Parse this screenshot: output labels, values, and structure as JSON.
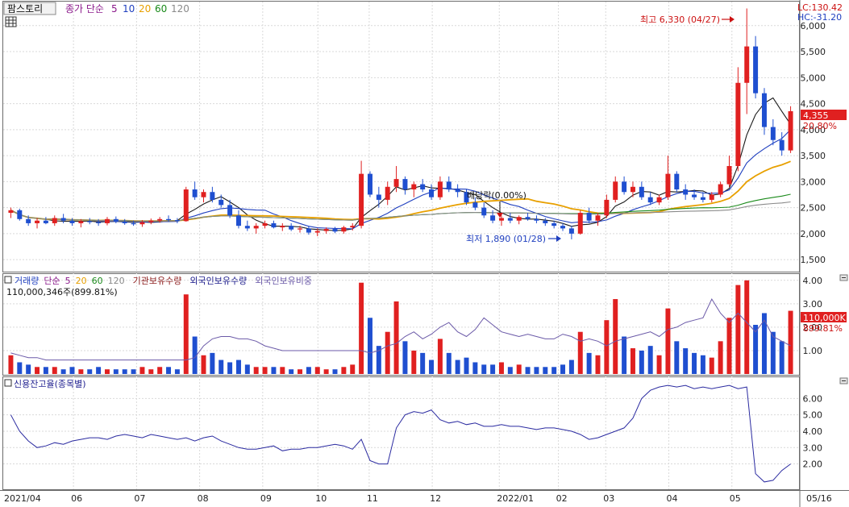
{
  "price_panel": {
    "stock_name": "팜스토리",
    "ma_label": "종가 단순",
    "ma_periods": [
      "5",
      "10",
      "20",
      "60",
      "120"
    ],
    "ma_colors": [
      "#1a1a1a",
      "#1f3fbf",
      "#e8a000",
      "#1a8a1a",
      "#8a8a8a"
    ],
    "lc_text": "LC:130.42",
    "hc_text": "HC:-31.20",
    "high_annotation": "최고 6,330 (04/27)",
    "low_annotation": "최저 1,890 (01/28)",
    "dividend_annotation": "배당락(0.00%)",
    "current_price": "4,355",
    "change_pct": "20.80%",
    "y_ticks": [
      "6,000",
      "5,500",
      "5,000",
      "4,500",
      "4,000",
      "3,500",
      "3,000",
      "2,500",
      "2,000",
      "1,500"
    ]
  },
  "volume_panel": {
    "labels": [
      "거래량",
      "단순",
      "5",
      "20",
      "60",
      "120",
      "기관보유수량",
      "외국인보유수량",
      "외국인보유비중"
    ],
    "label_colors": [
      "#1f3fbf",
      "#8b1a8b",
      "#8b1a8b",
      "#e8a000",
      "#1a8a1a",
      "#8a8a8a",
      "#8b1a1a",
      "#1a1a8b",
      "#6b5aa8"
    ],
    "summary": "110,000,346주(899.81%)",
    "value_badge": "110,000K",
    "pct_badge": "899.81%",
    "y_ticks": [
      "4.00",
      "3.00",
      "2.00",
      "1.00"
    ]
  },
  "credit_panel": {
    "title": "신용잔고율(종목별)",
    "y_ticks": [
      "6.00",
      "5.00",
      "4.00",
      "3.00",
      "2.00"
    ]
  },
  "x_axis": {
    "labels": [
      "2021/04",
      "06",
      "07",
      "08",
      "09",
      "10",
      "11",
      "12",
      "2022/01",
      "02",
      "03",
      "04",
      "05",
      "05/16"
    ]
  },
  "chart_data": {
    "type": "candlestick",
    "candles": [
      [
        2400,
        2500,
        2300,
        2450
      ],
      [
        2450,
        2480,
        2250,
        2280
      ],
      [
        2280,
        2350,
        2150,
        2200
      ],
      [
        2200,
        2300,
        2100,
        2250
      ],
      [
        2250,
        2320,
        2180,
        2200
      ],
      [
        2200,
        2350,
        2150,
        2300
      ],
      [
        2300,
        2380,
        2200,
        2250
      ],
      [
        2250,
        2300,
        2150,
        2200
      ],
      [
        2200,
        2280,
        2120,
        2240
      ],
      [
        2240,
        2300,
        2180,
        2220
      ],
      [
        2220,
        2280,
        2150,
        2200
      ],
      [
        2200,
        2320,
        2160,
        2280
      ],
      [
        2280,
        2330,
        2200,
        2230
      ],
      [
        2230,
        2280,
        2170,
        2200
      ],
      [
        2200,
        2250,
        2150,
        2180
      ],
      [
        2180,
        2260,
        2130,
        2220
      ],
      [
        2220,
        2290,
        2180,
        2250
      ],
      [
        2250,
        2320,
        2210,
        2280
      ],
      [
        2280,
        2350,
        2230,
        2260
      ],
      [
        2260,
        2300,
        2200,
        2240
      ],
      [
        2240,
        2900,
        2230,
        2850
      ],
      [
        2850,
        3000,
        2650,
        2700
      ],
      [
        2700,
        2850,
        2600,
        2800
      ],
      [
        2800,
        2900,
        2600,
        2650
      ],
      [
        2650,
        2750,
        2500,
        2550
      ],
      [
        2550,
        2650,
        2300,
        2350
      ],
      [
        2350,
        2450,
        2100,
        2150
      ],
      [
        2150,
        2250,
        2050,
        2100
      ],
      [
        2100,
        2200,
        2000,
        2150
      ],
      [
        2150,
        2250,
        2100,
        2200
      ],
      [
        2200,
        2250,
        2100,
        2120
      ],
      [
        2120,
        2200,
        2050,
        2150
      ],
      [
        2150,
        2200,
        2050,
        2080
      ],
      [
        2080,
        2150,
        2020,
        2100
      ],
      [
        2100,
        2140,
        1980,
        2020
      ],
      [
        2020,
        2100,
        1950,
        2050
      ],
      [
        2050,
        2120,
        2000,
        2090
      ],
      [
        2090,
        2130,
        2010,
        2040
      ],
      [
        2040,
        2150,
        2000,
        2120
      ],
      [
        2120,
        2200,
        2060,
        2150
      ],
      [
        2150,
        3400,
        2100,
        3150
      ],
      [
        3150,
        3200,
        2700,
        2750
      ],
      [
        2750,
        2900,
        2500,
        2650
      ],
      [
        2650,
        3000,
        2550,
        2900
      ],
      [
        2900,
        3300,
        2800,
        3050
      ],
      [
        3050,
        3100,
        2750,
        2850
      ],
      [
        2850,
        3000,
        2700,
        2950
      ],
      [
        2950,
        3050,
        2800,
        2850
      ],
      [
        2850,
        2950,
        2650,
        2700
      ],
      [
        2700,
        3100,
        2650,
        3000
      ],
      [
        3000,
        3100,
        2800,
        2850
      ],
      [
        2850,
        2950,
        2700,
        2800
      ],
      [
        2800,
        2850,
        2550,
        2600
      ],
      [
        2600,
        2700,
        2450,
        2500
      ],
      [
        2500,
        2600,
        2300,
        2350
      ],
      [
        2350,
        2450,
        2200,
        2250
      ],
      [
        2250,
        2350,
        2150,
        2300
      ],
      [
        2300,
        2400,
        2200,
        2250
      ],
      [
        2250,
        2350,
        2180,
        2320
      ],
      [
        2320,
        2400,
        2250,
        2280
      ],
      [
        2280,
        2350,
        2200,
        2250
      ],
      [
        2250,
        2300,
        2150,
        2200
      ],
      [
        2200,
        2250,
        2100,
        2150
      ],
      [
        2150,
        2200,
        2050,
        2100
      ],
      [
        2100,
        2150,
        1890,
        2000
      ],
      [
        2000,
        2450,
        1980,
        2400
      ],
      [
        2400,
        2500,
        2200,
        2250
      ],
      [
        2250,
        2400,
        2150,
        2350
      ],
      [
        2350,
        2750,
        2300,
        2650
      ],
      [
        2650,
        3100,
        2600,
        3000
      ],
      [
        3000,
        3100,
        2750,
        2800
      ],
      [
        2800,
        3000,
        2700,
        2900
      ],
      [
        2900,
        3000,
        2650,
        2700
      ],
      [
        2700,
        2800,
        2550,
        2600
      ],
      [
        2600,
        2750,
        2550,
        2700
      ],
      [
        2700,
        3500,
        2650,
        3150
      ],
      [
        3150,
        3200,
        2800,
        2850
      ],
      [
        2850,
        2950,
        2650,
        2750
      ],
      [
        2750,
        2850,
        2650,
        2700
      ],
      [
        2700,
        2800,
        2600,
        2650
      ],
      [
        2650,
        2800,
        2600,
        2750
      ],
      [
        2750,
        3000,
        2700,
        2950
      ],
      [
        2950,
        3500,
        2900,
        3300
      ],
      [
        3300,
        5200,
        3200,
        4900
      ],
      [
        4900,
        6330,
        4300,
        5600
      ],
      [
        5600,
        5800,
        4600,
        4700
      ],
      [
        4700,
        4800,
        3900,
        4050
      ],
      [
        4050,
        4200,
        3700,
        3800
      ],
      [
        3800,
        3950,
        3500,
        3600
      ],
      [
        3600,
        4450,
        3550,
        4355
      ]
    ],
    "ylim": [
      1300,
      6400
    ],
    "high": 6330,
    "low": 1890,
    "ma_periods": [
      5,
      10,
      20,
      60,
      120
    ],
    "volume_ylim": [
      0,
      4.2
    ],
    "volume": [
      0.8,
      0.5,
      0.4,
      0.3,
      0.3,
      0.3,
      0.2,
      0.3,
      0.2,
      0.2,
      0.3,
      0.2,
      0.2,
      0.2,
      0.2,
      0.3,
      0.2,
      0.3,
      0.3,
      0.2,
      3.4,
      1.6,
      0.8,
      0.9,
      0.6,
      0.5,
      0.6,
      0.4,
      0.3,
      0.3,
      0.3,
      0.3,
      0.2,
      0.2,
      0.3,
      0.3,
      0.2,
      0.2,
      0.3,
      0.4,
      3.9,
      2.4,
      1.2,
      1.8,
      3.1,
      1.4,
      1.0,
      0.9,
      0.6,
      1.5,
      0.9,
      0.6,
      0.7,
      0.5,
      0.4,
      0.4,
      0.5,
      0.3,
      0.4,
      0.3,
      0.3,
      0.3,
      0.3,
      0.4,
      0.6,
      1.8,
      0.9,
      0.8,
      2.3,
      3.2,
      1.6,
      1.1,
      1.0,
      1.2,
      0.8,
      2.8,
      1.4,
      1.1,
      0.9,
      0.8,
      0.7,
      1.4,
      2.4,
      3.8,
      4.0,
      2.1,
      2.6,
      1.8,
      1.4,
      2.7
    ],
    "foreign_ratio": [
      0.9,
      0.8,
      0.7,
      0.7,
      0.6,
      0.6,
      0.6,
      0.6,
      0.6,
      0.6,
      0.6,
      0.6,
      0.6,
      0.6,
      0.6,
      0.6,
      0.6,
      0.6,
      0.6,
      0.6,
      0.6,
      0.7,
      1.2,
      1.5,
      1.6,
      1.6,
      1.5,
      1.5,
      1.4,
      1.2,
      1.1,
      1.0,
      1.0,
      1.0,
      1.0,
      1.0,
      1.0,
      1.0,
      1.0,
      1.0,
      1.0,
      0.9,
      1.0,
      1.2,
      1.3,
      1.6,
      1.8,
      1.5,
      1.7,
      2.0,
      2.2,
      1.8,
      1.6,
      1.9,
      2.4,
      2.1,
      1.8,
      1.7,
      1.6,
      1.7,
      1.6,
      1.5,
      1.5,
      1.7,
      1.6,
      1.4,
      1.5,
      1.4,
      1.2,
      1.4,
      1.5,
      1.6,
      1.7,
      1.8,
      1.6,
      1.9,
      2.0,
      2.2,
      2.3,
      2.4,
      3.2,
      2.6,
      2.2,
      2.6,
      2.2,
      1.8,
      2.3,
      1.6,
      1.4,
      1.2
    ],
    "credit_ylim": [
      0.5,
      7.2
    ],
    "credit_ratio": [
      5.0,
      4.0,
      3.4,
      3.0,
      3.1,
      3.3,
      3.2,
      3.4,
      3.5,
      3.6,
      3.6,
      3.5,
      3.7,
      3.8,
      3.7,
      3.6,
      3.8,
      3.7,
      3.6,
      3.5,
      3.6,
      3.4,
      3.6,
      3.7,
      3.4,
      3.2,
      3.0,
      2.9,
      2.9,
      3.0,
      3.1,
      2.8,
      2.9,
      2.9,
      3.0,
      3.0,
      3.1,
      3.2,
      3.1,
      2.9,
      3.5,
      2.2,
      2.0,
      2.0,
      4.2,
      5.0,
      5.2,
      5.1,
      5.3,
      4.7,
      4.5,
      4.6,
      4.4,
      4.5,
      4.3,
      4.3,
      4.4,
      4.3,
      4.3,
      4.2,
      4.1,
      4.2,
      4.2,
      4.1,
      4.0,
      3.8,
      3.5,
      3.6,
      3.8,
      4.0,
      4.2,
      4.8,
      6.0,
      6.5,
      6.7,
      6.8,
      6.7,
      6.8,
      6.6,
      6.7,
      6.6,
      6.7,
      6.8,
      6.6,
      6.7,
      1.4,
      0.9,
      1.0,
      1.6,
      2.0
    ]
  }
}
